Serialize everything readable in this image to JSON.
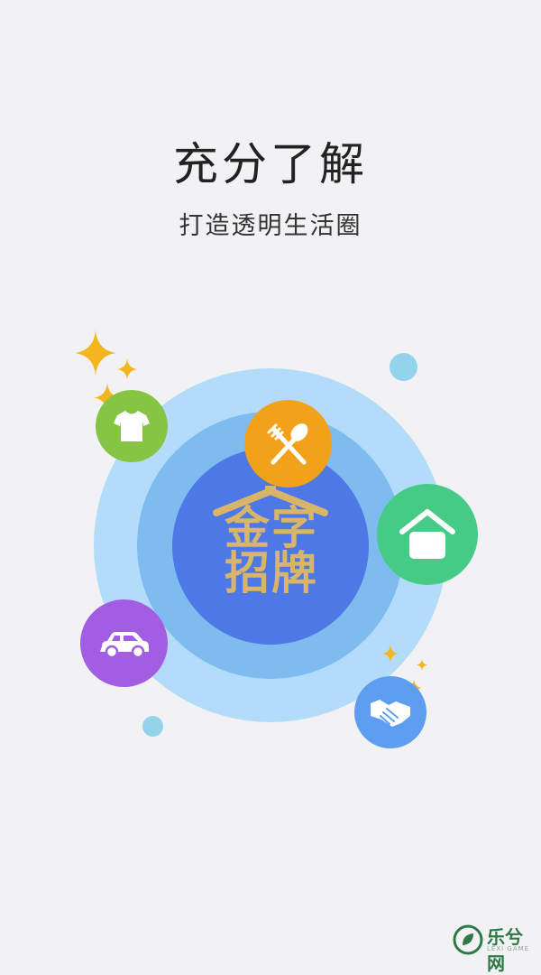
{
  "header": {
    "title": "充分了解",
    "subtitle": "打造透明生活圈"
  },
  "logo": {
    "text_line1": "金字",
    "text_line2": "招牌"
  },
  "categories": [
    {
      "icon": "shirt-icon",
      "color": "#86c443"
    },
    {
      "icon": "fork-spoon-icon",
      "color": "#f2a11a"
    },
    {
      "icon": "house-icon",
      "color": "#45cb85"
    },
    {
      "icon": "car-icon",
      "color": "#a25de2"
    },
    {
      "icon": "handshake-icon",
      "color": "#5d9ef0"
    }
  ],
  "watermark": {
    "text": "乐兮网",
    "sub": "LEXI GAME"
  }
}
